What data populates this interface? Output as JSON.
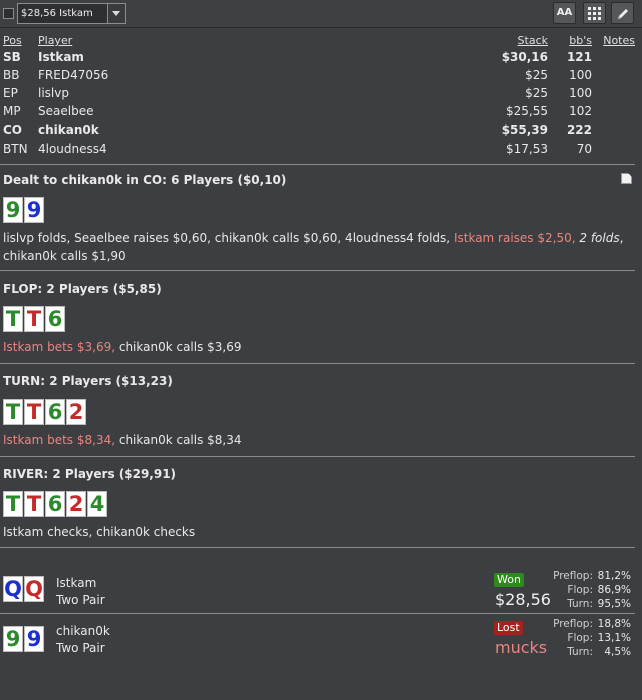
{
  "toolbar": {
    "hand_select_value": "$28,56 Istkam",
    "font_button_label": "AA",
    "grid_icon": "grid-icon",
    "edit_icon": "pencil-icon"
  },
  "players": {
    "headers": {
      "pos": "Pos",
      "player": "Player",
      "stack": "Stack",
      "bbs": "bb's",
      "notes": "Notes"
    },
    "rows": [
      {
        "pos": "SB",
        "name": "Istkam",
        "stack": "$30,16",
        "bbs": "121"
      },
      {
        "pos": "BB",
        "name": "FRED47056",
        "stack": "$25",
        "bbs": "100"
      },
      {
        "pos": "EP",
        "name": "lislvp",
        "stack": "$25",
        "bbs": "100"
      },
      {
        "pos": "MP",
        "name": "Seaelbee",
        "stack": "$25,55",
        "bbs": "102"
      },
      {
        "pos": "CO",
        "name": "chikan0k",
        "stack": "$55,39",
        "bbs": "222"
      },
      {
        "pos": "BTN",
        "name": "4loudness4",
        "stack": "$17,53",
        "bbs": "70"
      }
    ]
  },
  "preflop": {
    "title": "Dealt to chikan0k in CO: 6 Players ($0,10)",
    "cards": [
      "9",
      "9"
    ],
    "action_1": "lislvp folds, Seaelbee raises $0,60, chikan0k calls $0,60, 4loudness4 folds,",
    "action_hero": "Istkam raises $2,50,",
    "action_folds": "2 folds",
    "action_2": ", chikan0k calls $1,90"
  },
  "flop": {
    "title": "FLOP: 2 Players ($5,85)",
    "cards": [
      "T",
      "T",
      "6"
    ],
    "action_hero": "Istkam bets $3,69,",
    "action_rest": " chikan0k calls $3,69"
  },
  "turn": {
    "title": "TURN: 2 Players ($13,23)",
    "cards": [
      "T",
      "T",
      "6",
      "2"
    ],
    "action_hero": "Istkam bets $8,34,",
    "action_rest": " chikan0k calls $8,34"
  },
  "river": {
    "title": "RIVER: 2 Players ($29,91)",
    "cards": [
      "T",
      "T",
      "6",
      "2",
      "4"
    ],
    "action_rest": "Istkam checks, chikan0k checks"
  },
  "results": [
    {
      "cards": [
        "Q",
        "Q"
      ],
      "name": "Istkam",
      "hand": "Two Pair",
      "badge": "Won",
      "amount": "$28,56",
      "equity": [
        {
          "label": "Preflop:",
          "value": "81,2%"
        },
        {
          "label": "Flop:",
          "value": "86,9%"
        },
        {
          "label": "Turn:",
          "value": "95,5%"
        }
      ]
    },
    {
      "cards": [
        "9",
        "9"
      ],
      "name": "chikan0k",
      "hand": "Two Pair",
      "badge": "Lost",
      "amount": "mucks",
      "equity": [
        {
          "label": "Preflop:",
          "value": "18,8%"
        },
        {
          "label": "Flop:",
          "value": "13,1%"
        },
        {
          "label": "Turn:",
          "value": "4,5%"
        }
      ]
    }
  ],
  "colors": {
    "background": "#3c3e42",
    "hero_action": "#e7877f",
    "card_green": "#2c8a2c",
    "card_red": "#c52a2a",
    "card_blue": "#1c2fd0",
    "won_badge": "#2f8a1c",
    "lost_badge": "#a0231e"
  }
}
